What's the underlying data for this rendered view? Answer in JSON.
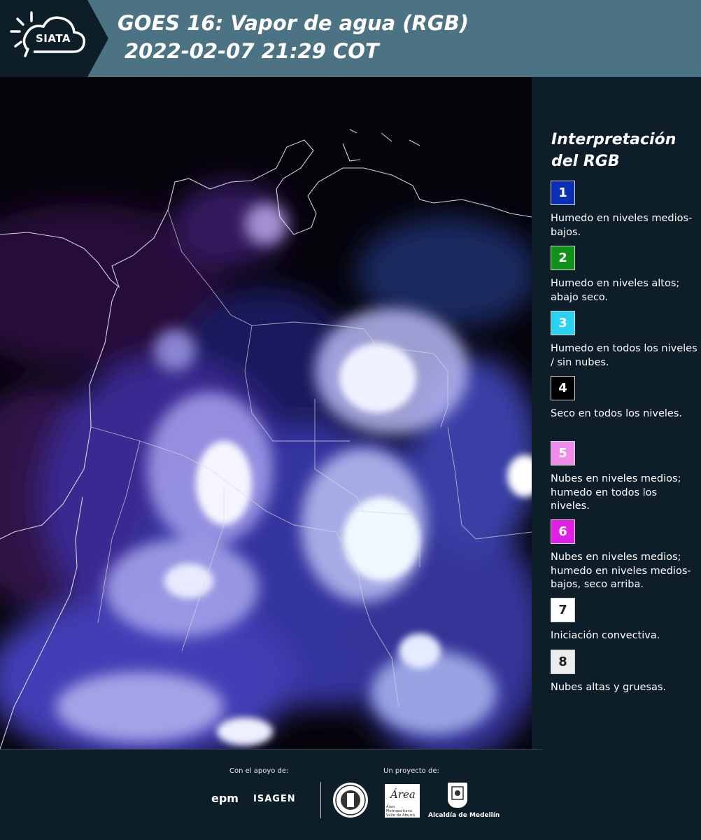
{
  "header": {
    "logo_text": "SIATA",
    "title_line1": "GOES 16: Vapor de agua (RGB)",
    "title_line2": "2022-02-07 21:29 COT"
  },
  "legend": {
    "title": "Interpretación del RGB",
    "items": [
      {
        "number": "1",
        "color": "#0a2fb4",
        "text": "Humedo en niveles medios-bajos."
      },
      {
        "number": "2",
        "color": "#129118",
        "text": "Humedo en niveles altos; abajo seco."
      },
      {
        "number": "3",
        "color": "#29d3ef",
        "text": "Humedo en todos los niveles / sin nubes."
      },
      {
        "number": "4",
        "color": "#000000",
        "text": "Seco en todos los niveles."
      },
      {
        "number": "5",
        "color": "#f08ce9",
        "text": "Nubes en niveles medios; humedo en todos los niveles."
      },
      {
        "number": "6",
        "color": "#e020e6",
        "text": "Nubes en niveles medios; humedo en niveles medios-bajos, seco arriba."
      },
      {
        "number": "7",
        "color": "#ffffff",
        "text": "Iniciación convectiva."
      },
      {
        "number": "8",
        "color": "#ececec",
        "text": "Nubes altas y gruesas."
      }
    ]
  },
  "footer": {
    "support_label": "Con el apoyo de:",
    "project_label": "Un proyecto de:",
    "sponsors": [
      "epm",
      "ISAGEN"
    ],
    "partners": [
      "Área Metropolitana Valle de Aburrá",
      "Alcaldía de Medellín"
    ]
  }
}
